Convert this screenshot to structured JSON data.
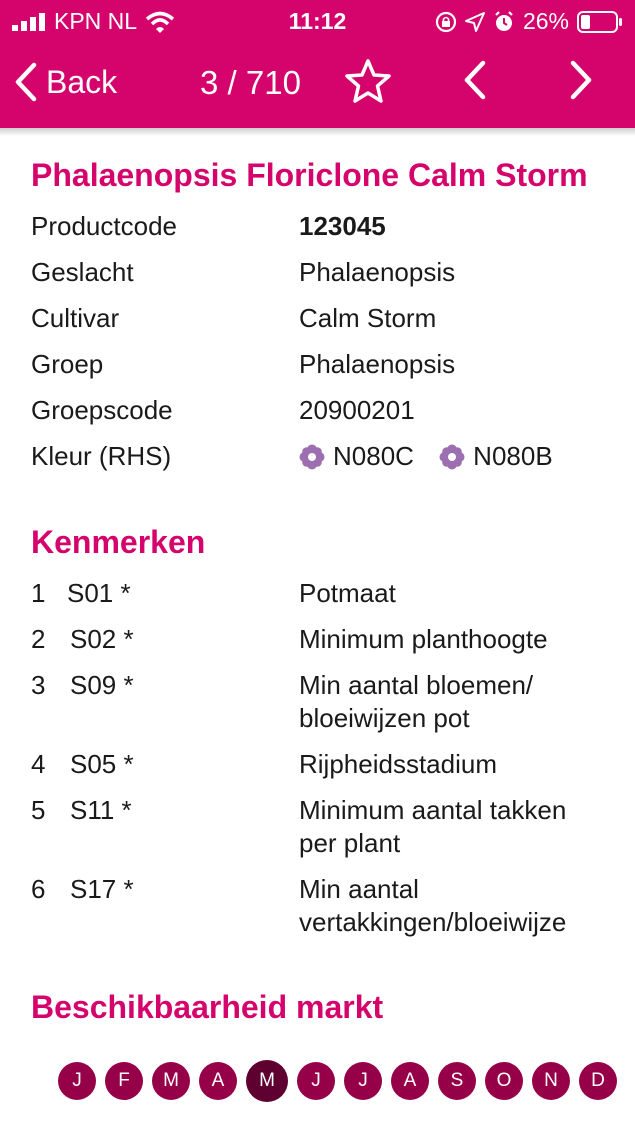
{
  "status_bar": {
    "carrier": "KPN NL",
    "time": "11:12",
    "battery": "26%"
  },
  "nav": {
    "back_label": "Back",
    "counter": "3 / 710",
    "icons": [
      "chevron-left-icon",
      "star-icon",
      "chevron-left-icon",
      "chevron-right-icon"
    ]
  },
  "product": {
    "title": "Phalaenopsis Floriclone Calm Storm",
    "fields": [
      {
        "label": "Productcode",
        "value": "123045"
      },
      {
        "label": "Geslacht",
        "value": "Phalaenopsis"
      },
      {
        "label": "Cultivar",
        "value": "Calm Storm"
      },
      {
        "label": "Groep",
        "value": "Phalaenopsis"
      },
      {
        "label": "Groepscode",
        "value": "20900201"
      },
      {
        "label": "Kleur (RHS)",
        "colors": [
          "N080C",
          "N080B"
        ]
      }
    ]
  },
  "kenmerken": {
    "title": "Kenmerken",
    "items": [
      {
        "num": "1",
        "code": "S01 *",
        "desc": "Potmaat"
      },
      {
        "num": "2",
        "code": "S02 *",
        "desc": "Minimum planthoogte"
      },
      {
        "num": "3",
        "code": "S09 *",
        "desc": "Min aantal bloemen/ bloeiwijzen pot"
      },
      {
        "num": "4",
        "code": "S05 *",
        "desc": "Rijpheidsstadium"
      },
      {
        "num": "5",
        "code": "S11 *",
        "desc": "Minimum aantal takken per plant"
      },
      {
        "num": "6",
        "code": "S17 *",
        "desc": "Min aantal vertakkingen/bloeiwijze"
      }
    ]
  },
  "availability": {
    "title": "Beschikbaarheid markt",
    "months": [
      "J",
      "F",
      "M",
      "A",
      "M",
      "J",
      "J",
      "A",
      "S",
      "O",
      "N",
      "D"
    ],
    "selected_index": 4
  },
  "colors": {
    "brand": "#d5046c",
    "month_circle": "#960048",
    "month_selected": "#5e0030",
    "flower_icon": "#9c6fb0"
  }
}
